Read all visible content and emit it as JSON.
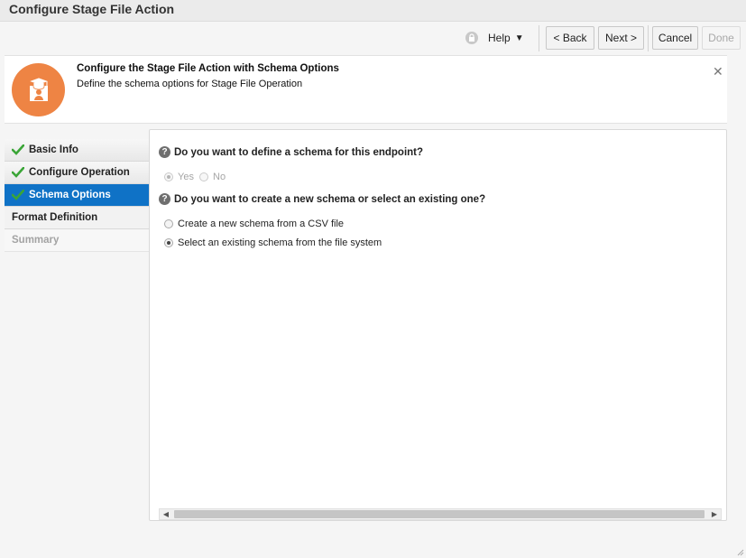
{
  "window": {
    "title": "Configure Stage File Action"
  },
  "toolbar": {
    "help_label": "Help",
    "help_arrow": "▼",
    "back_label": "< Back",
    "next_label": "Next >",
    "cancel_label": "Cancel",
    "done_label": "Done"
  },
  "header": {
    "title": "Configure the Stage File Action with Schema Options",
    "subtitle": "Define the schema options for Stage File Operation",
    "close_glyph": "✕"
  },
  "nav": {
    "items": [
      {
        "label": "Basic Info",
        "state": "done"
      },
      {
        "label": "Configure Operation",
        "state": "done"
      },
      {
        "label": "Schema Options",
        "state": "active"
      },
      {
        "label": "Format Definition",
        "state": "plain"
      },
      {
        "label": "Summary",
        "state": "disabled"
      }
    ]
  },
  "content": {
    "q1": {
      "text": "Do you want to define a schema for this endpoint?",
      "yes": "Yes",
      "no": "No",
      "selected": "Yes"
    },
    "q2": {
      "text": "Do you want to create a new schema or select an existing one?",
      "opt1": "Create a new schema from a CSV file",
      "opt2": "Select an existing schema from the file system",
      "selected": "opt2"
    },
    "help_glyph": "?"
  },
  "colors": {
    "accent": "#0f72c6",
    "header_icon": "#ee8444",
    "check": "#3aa537"
  },
  "icons": {
    "lock": "lock-icon",
    "close": "close-icon",
    "check": "check-icon",
    "help": "help-icon",
    "header": "graduate-document-icon"
  }
}
